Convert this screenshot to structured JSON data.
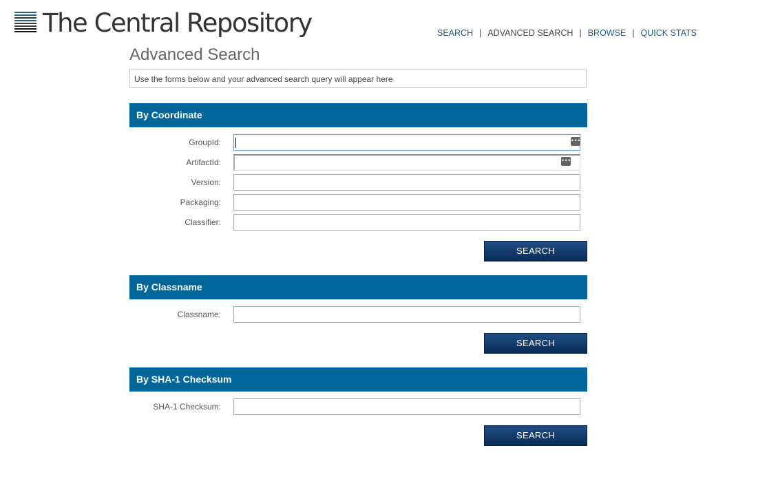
{
  "brand": {
    "title": "The Central Repository",
    "accent": "#006699",
    "logo_colors": [
      "#2b5f8f",
      "#2b5f8f",
      "#3a3a3a",
      "#2b5f8f",
      "#3a3a3a",
      "#3a3a3a",
      "#111111",
      "#111111"
    ]
  },
  "nav": {
    "items": [
      "SEARCH",
      "ADVANCED SEARCH",
      "BROWSE",
      "QUICK STATS"
    ],
    "separator": "|",
    "active": "ADVANCED SEARCH"
  },
  "page": {
    "title": "Advanced Search"
  },
  "query_box": {
    "text": "Use the forms below and your advanced search query will appear here"
  },
  "sections": {
    "coordinate": {
      "title": "By Coordinate",
      "fields": [
        {
          "label": "GroupId:",
          "value": ""
        },
        {
          "label": "ArtifactId:",
          "value": ""
        },
        {
          "label": "Version:",
          "value": ""
        },
        {
          "label": "Packaging:",
          "value": ""
        },
        {
          "label": "Classifier:",
          "value": ""
        }
      ],
      "button": "SEARCH"
    },
    "classname": {
      "title": "By Classname",
      "fields": [
        {
          "label": "Classname:",
          "value": ""
        }
      ],
      "button": "SEARCH"
    },
    "sha1": {
      "title": "By SHA-1 Checksum",
      "fields": [
        {
          "label": "SHA-1 Checksum:",
          "value": ""
        }
      ],
      "button": "SEARCH"
    }
  },
  "icons": {
    "autofill": "password-manager-icon",
    "autofill_glyph": "•••"
  }
}
